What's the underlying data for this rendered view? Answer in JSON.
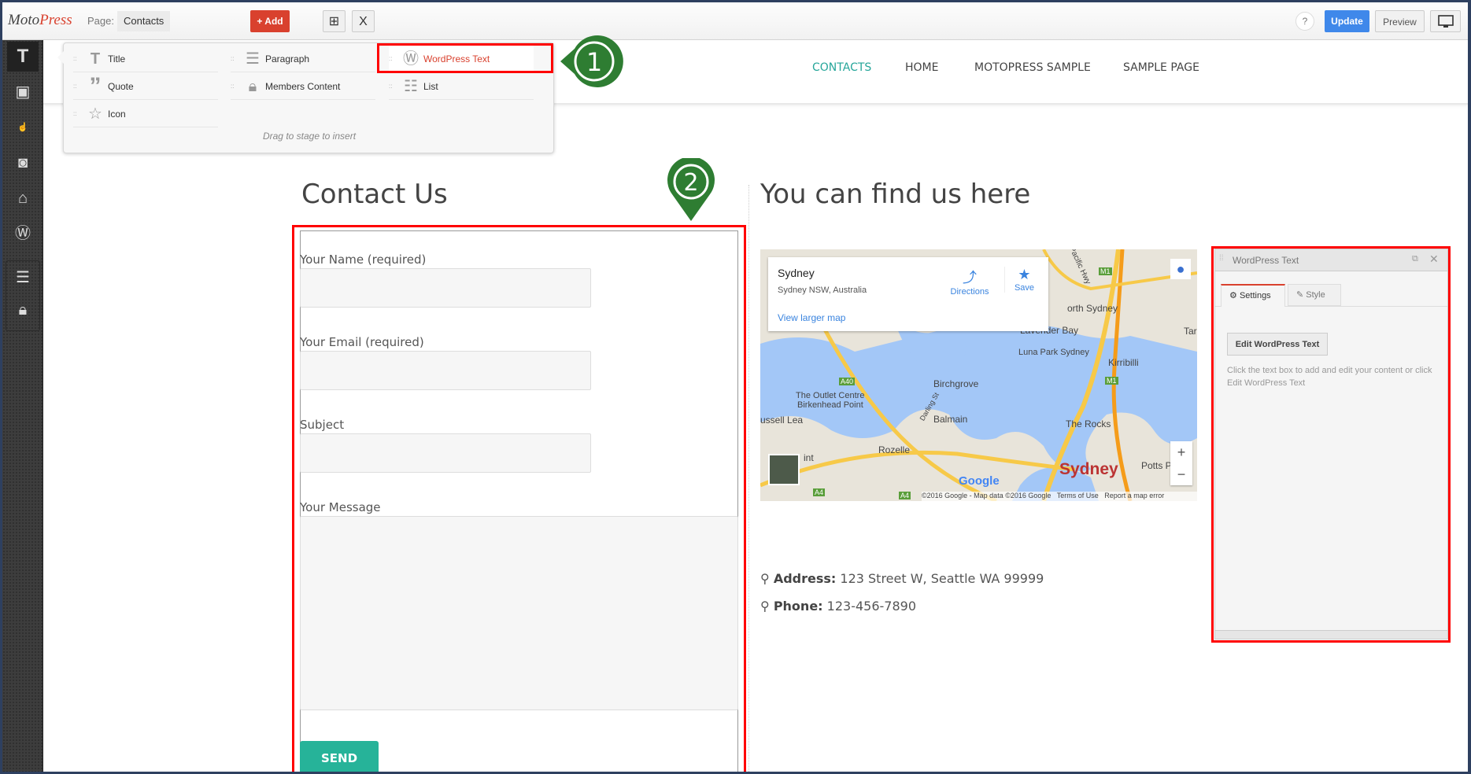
{
  "topbar": {
    "logo": "MotoPress",
    "page_label": "Page:",
    "page_name": "Contacts",
    "add_label": "+ Add",
    "duplicate_icon": "duplicate-icon",
    "close_label": "X",
    "help_label": "?",
    "update_label": "Update",
    "preview_label": "Preview",
    "device_icon": "monitor-icon"
  },
  "sidebar": {
    "items": [
      {
        "icon": "text-icon"
      },
      {
        "icon": "image-icon"
      },
      {
        "icon": "button-click-icon"
      },
      {
        "icon": "video-icon"
      },
      {
        "icon": "box-icon"
      },
      {
        "icon": "wordpress-icon"
      },
      {
        "icon": "layout-icon"
      },
      {
        "icon": "lock-icon"
      }
    ]
  },
  "nav": {
    "items": [
      "CONTACTS",
      "HOME",
      "MOTOPRESS SAMPLE",
      "SAMPLE PAGE"
    ],
    "active_color": "#26a69a"
  },
  "dropdown": {
    "items": [
      {
        "label": "Title",
        "icon": "title-T-icon"
      },
      {
        "label": "Paragraph",
        "icon": "paragraph-icon"
      },
      {
        "label": "WordPress Text",
        "icon": "wordpress-icon",
        "selected": true
      },
      {
        "label": "Quote",
        "icon": "quote-icon"
      },
      {
        "label": "Members Content",
        "icon": "lock-icon"
      },
      {
        "label": "List",
        "icon": "list-icon"
      },
      {
        "label": "Icon",
        "icon": "star-icon"
      }
    ],
    "hint": "Drag to stage to insert"
  },
  "annotations": {
    "step1": "1",
    "step2": "2",
    "marker_color": "#2e7d32",
    "highlight_color": "#ff0000"
  },
  "content": {
    "left_title": "Contact Us",
    "form": {
      "name_label": "Your Name (required)",
      "email_label": "Your Email (required)",
      "subject_label": "Subject",
      "message_label": "Your Message",
      "send_label": "SEND"
    },
    "right_title": "You can find us here",
    "map": {
      "place": "Sydney",
      "address": "Sydney NSW, Australia",
      "directions": "Directions",
      "save": "Save",
      "larger": "View larger map",
      "labels": [
        "orth Sydney",
        "Lavender Bay",
        "Luna Park Sydney",
        "Kirribilli",
        "Birchgrove",
        "The Outlet Centre",
        "Birkenhead Point",
        "ussell Lea",
        "Balmain",
        "Darling St",
        "The Rocks",
        "Rozelle",
        "Sydney",
        "Potts Po",
        "Taro",
        "int",
        "Pacific Hwy",
        "A40",
        "M1",
        "M1",
        "A4",
        "A4"
      ],
      "google": "Google",
      "footer": "©2016 Google - Map data ©2016 Google",
      "terms": "Terms of Use",
      "report": "Report a map error",
      "zoom_in": "+",
      "zoom_out": "−"
    },
    "address_label": "Address:",
    "address": "123 Street W, Seattle WA 99999",
    "phone_label": "Phone:",
    "phone": "123-456-7890"
  },
  "panel": {
    "title": "WordPress Text",
    "tabs": [
      "Settings",
      "Style"
    ],
    "edit_label": "Edit WordPress Text",
    "description": "Click the text box to add and edit your content or click Edit WordPress Text"
  }
}
